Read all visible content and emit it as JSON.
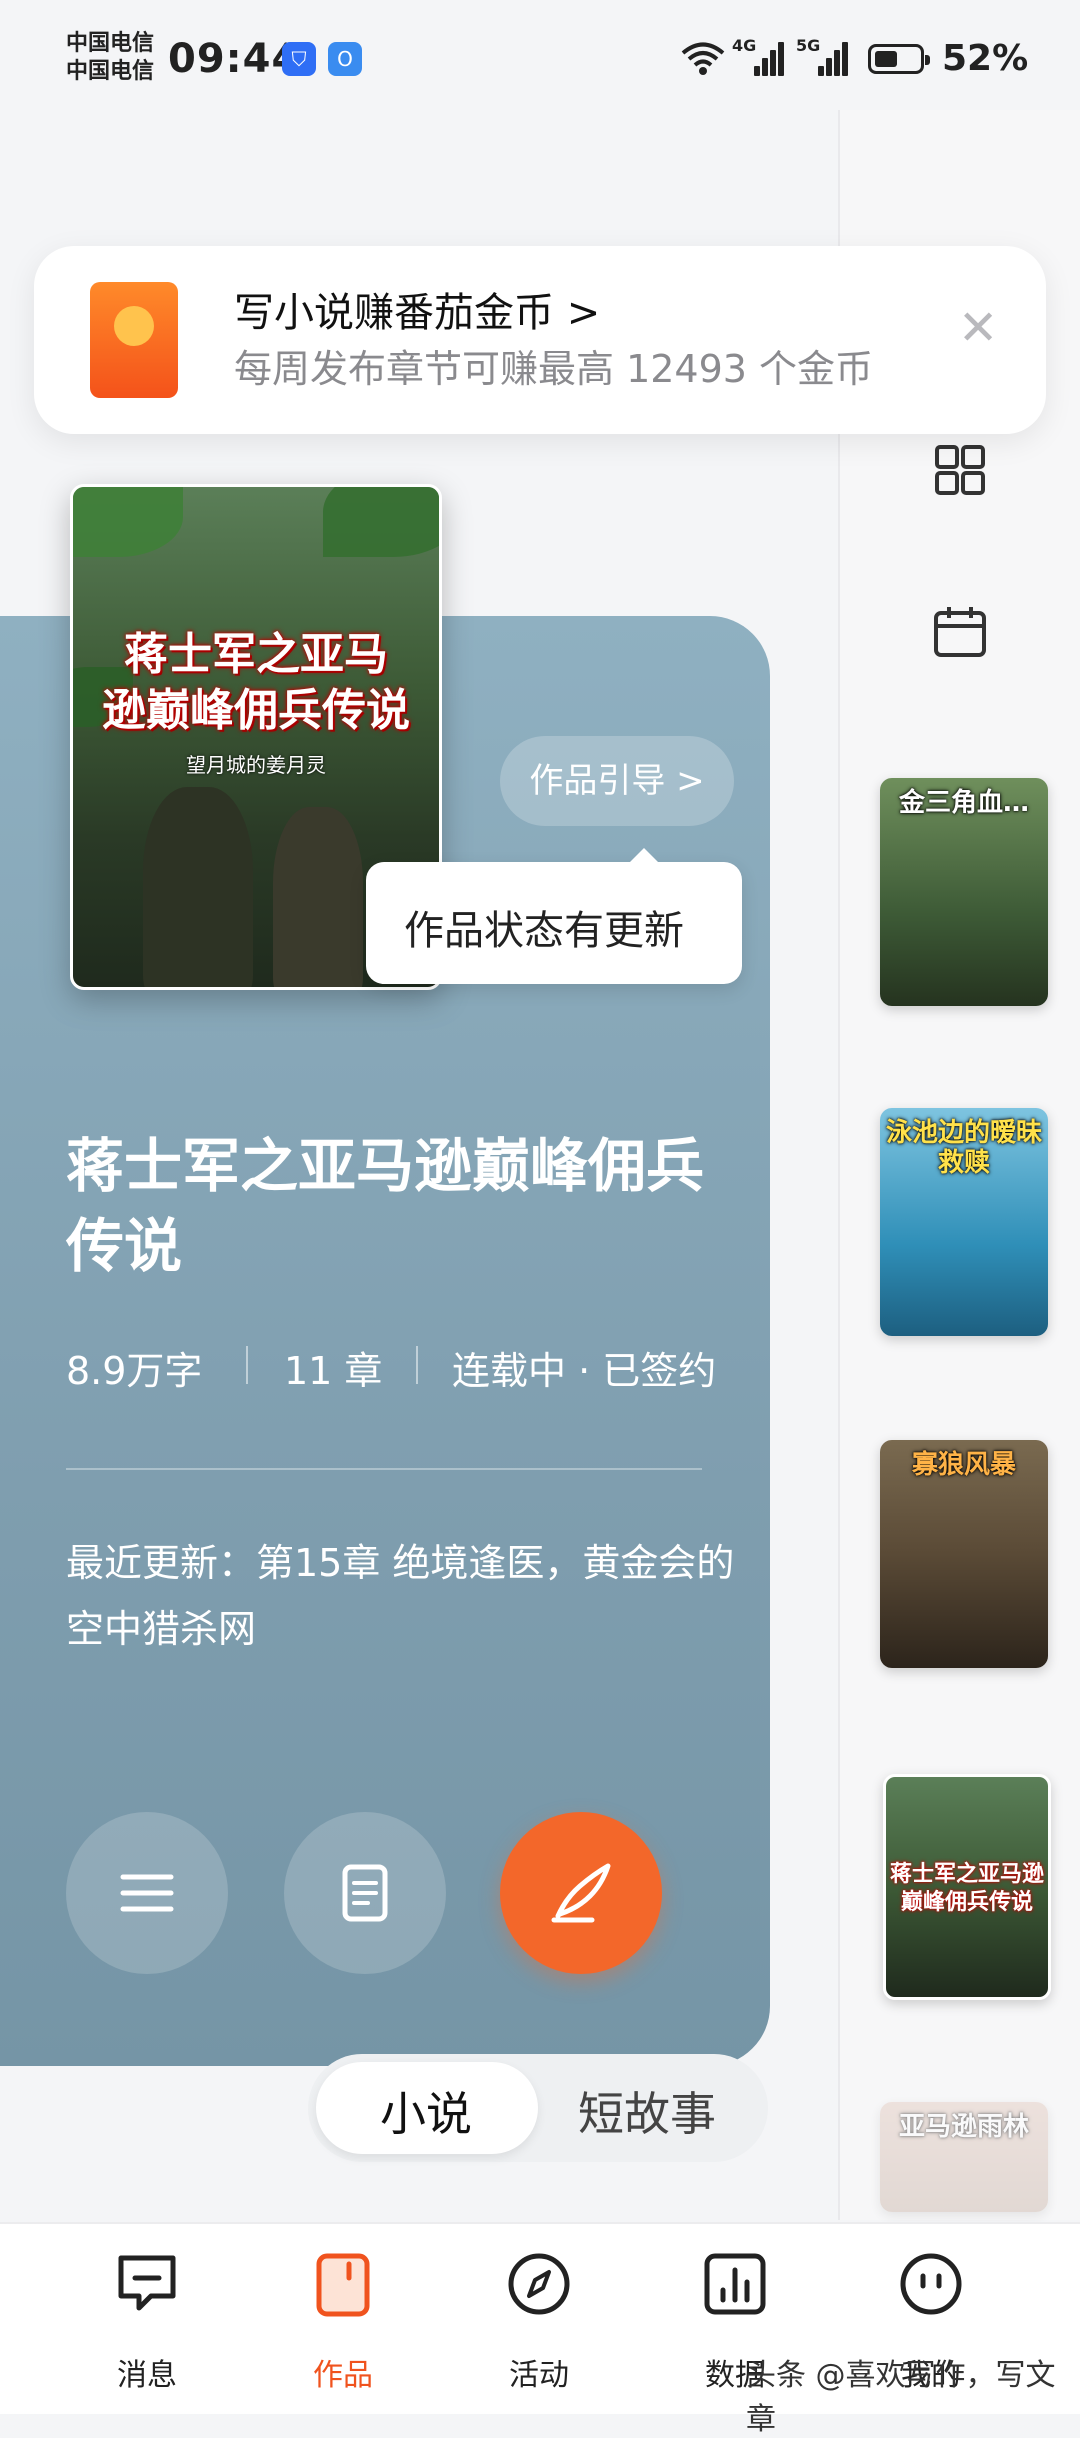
{
  "status_bar": {
    "carrier_1": "中国电信",
    "carrier_2": "中国电信",
    "time": "09:44",
    "net_1": "4G",
    "net_2": "5G",
    "battery_percent": "52%",
    "battery_level": 0.52
  },
  "banner": {
    "title": "写小说赚番茄金币 >",
    "subtitle": "每周发布章节可赚最高 12493 个金币",
    "close_glyph": "✕"
  },
  "book": {
    "cover_title": "蒋士军之亚马逊巅峰佣兵传说",
    "cover_title_line1": "蒋士军之亚马",
    "cover_title_line2": "逊巅峰佣兵传说",
    "cover_author": "望月城的姜月灵",
    "guide_label": "作品引导 >",
    "tooltip": "作品状态有更新",
    "title": "蒋士军之亚马逊巅峰佣兵传说",
    "word_count": "8.9万字",
    "chapters": "11 章",
    "status": "连载中 · 已签约",
    "recent_update": "最近更新：第15章 绝境逢医，黄金会的空中猎杀网"
  },
  "side_books": [
    {
      "title": "金三角血…",
      "color": "#3d5a36"
    },
    {
      "title": "泳池边的暧昧救赎",
      "color": "#2f8fb8"
    },
    {
      "title": "寡狼风暴",
      "color": "#5a4a36"
    },
    {
      "title": "蒋士军之亚马逊巅峰佣兵传说",
      "color": "#3d5a36"
    },
    {
      "title": "亚马逊雨林",
      "color": "#c9b4a8"
    }
  ],
  "segment": {
    "tab_novel": "小说",
    "tab_short": "短故事"
  },
  "nav": {
    "messages": "消息",
    "works": "作品",
    "activity": "活动",
    "data": "数据",
    "mine": "我的"
  },
  "watermark": "头条 @喜欢写作，写文章",
  "colors": {
    "accent": "#f3672a",
    "card": "#8aa9ba"
  }
}
